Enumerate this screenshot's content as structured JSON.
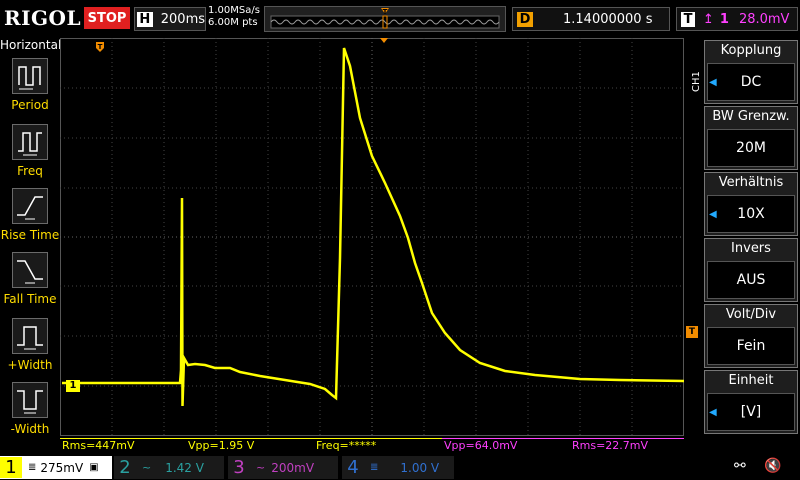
{
  "header": {
    "logo": "RIGOL",
    "run_status": "STOP",
    "timebase_label": "H",
    "timebase_value": "200ms",
    "sample_rate": "1.00MSa/s",
    "memory_depth": "6.00M pts",
    "delay_label": "D",
    "delay_value": "1.14000000 s",
    "trigger_label": "T",
    "trigger_source": "1",
    "trigger_level": "28.0mV"
  },
  "left_menu": {
    "title": "Horizontal",
    "items": [
      {
        "label": "Period",
        "icon": "period-icon"
      },
      {
        "label": "Freq",
        "icon": "freq-icon"
      },
      {
        "label": "Rise Time",
        "icon": "rise-time-icon"
      },
      {
        "label": "Fall Time",
        "icon": "fall-time-icon"
      },
      {
        "label": "+Width",
        "icon": "positive-width-icon"
      },
      {
        "label": "-Width",
        "icon": "negative-width-icon"
      }
    ]
  },
  "right_menu": {
    "channel": "CH1",
    "items": [
      {
        "title": "Kopplung",
        "value": "DC",
        "has_arrow": true
      },
      {
        "title": "BW Grenzw.",
        "value": "20M",
        "has_arrow": false
      },
      {
        "title": "Verhältnis",
        "value": "10X",
        "has_arrow": true
      },
      {
        "title": "Invers",
        "value": "AUS",
        "has_arrow": false
      },
      {
        "title": "Volt/Div",
        "value": "Fein",
        "has_arrow": false
      },
      {
        "title": "Einheit",
        "value": "[V]",
        "has_arrow": true
      }
    ]
  },
  "waveform": {
    "channel_marker": "1",
    "trace_color": "#ffff00"
  },
  "measurements": [
    {
      "text": "Rms=447mV",
      "color": "#ffff00"
    },
    {
      "text": "Vpp=1.95 V",
      "color": "#ffff00"
    },
    {
      "text": "Freq=*****",
      "color": "#ffff00"
    },
    {
      "text": "Vpp=64.0mV",
      "color": "#ff40ff"
    },
    {
      "text": "Rms=22.7mV",
      "color": "#ff40ff"
    }
  ],
  "channels": [
    {
      "num": "1",
      "scale": "275mV",
      "color": "#ffff00",
      "active": true
    },
    {
      "num": "2",
      "scale": "1.42 V",
      "color": "#2aa0a0",
      "active": false
    },
    {
      "num": "3",
      "scale": "200mV",
      "color": "#c040c0",
      "active": false
    },
    {
      "num": "4",
      "scale": "1.00 V",
      "color": "#3070d0",
      "active": false
    }
  ],
  "colors": {
    "ch1": "#ffff00",
    "trigger": "#ff40ff",
    "orange_marker": "#f28c00",
    "stop": "#e02020"
  }
}
